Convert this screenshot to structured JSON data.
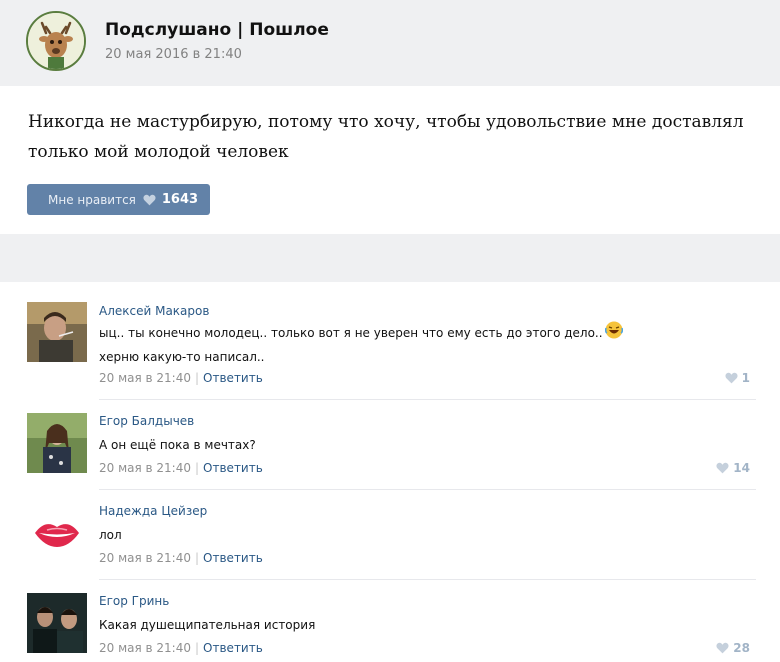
{
  "post": {
    "group_name": "Подслушано | Пошлое",
    "date": "20 мая 2016 в 21:40",
    "text": "Никогда не мастурбирую, потому что хочу, чтобы удовольствие мне доставлял только мой молодой человек",
    "like_label": "Мне нравится",
    "like_count": "1643"
  },
  "colors": {
    "accent": "#6282a8",
    "link": "#2a5885",
    "gray_bg": "#eff0f2"
  },
  "comments": [
    {
      "author": "Алексей Макаров",
      "text_before": "ыц.. ты конечно молодец.. только вот я не уверен что ему есть до этого дело..",
      "emoji": "laughing-emoji",
      "text_after": " херню какую-то написал..",
      "date": "20 мая в 21:40",
      "reply": "Ответить",
      "likes": "1"
    },
    {
      "author": "Егор Балдычев",
      "text": "А он ещё пока в мечтах?",
      "date": "20 мая в 21:40",
      "reply": "Ответить",
      "likes": "14"
    },
    {
      "author": "Надежда Цейзер",
      "text": "лол",
      "date": "20 мая в 21:40",
      "reply": "Ответить",
      "likes": ""
    },
    {
      "author": "Егор Гринь",
      "text": "Какая душещипательная история",
      "date": "20 мая в 21:40",
      "reply": "Ответить",
      "likes": "28"
    }
  ]
}
